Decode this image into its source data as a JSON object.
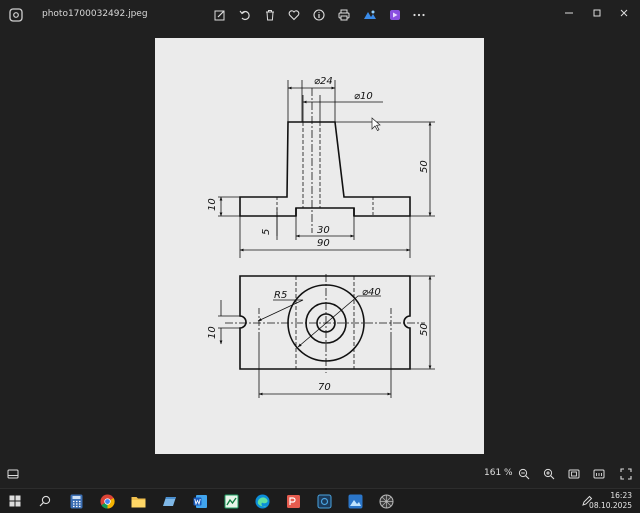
{
  "window": {
    "filename": "photo1700032492.jpeg"
  },
  "toolbar": {
    "icons": [
      "edit-image-icon",
      "rotate-icon",
      "delete-icon",
      "favorite-icon",
      "info-icon",
      "print-icon",
      "edit-app-icon",
      "clipchamp-icon",
      "more-icon"
    ]
  },
  "drawing": {
    "dim_top_width": "⌀24",
    "dim_hole": "⌀10",
    "dim_height": "50",
    "dim_base_thickness": "10",
    "dim_step": "5",
    "dim_slot_width": "30",
    "dim_overall_width": "90",
    "dim_radius": "R5",
    "dim_circle": "⌀40",
    "dim_slot_height": "10",
    "dim_plan_height": "50",
    "dim_hole_spacing": "70"
  },
  "statusbar": {
    "zoom": "161 %"
  },
  "taskbar": {
    "time": "16:23",
    "date": "08.10.2025"
  }
}
